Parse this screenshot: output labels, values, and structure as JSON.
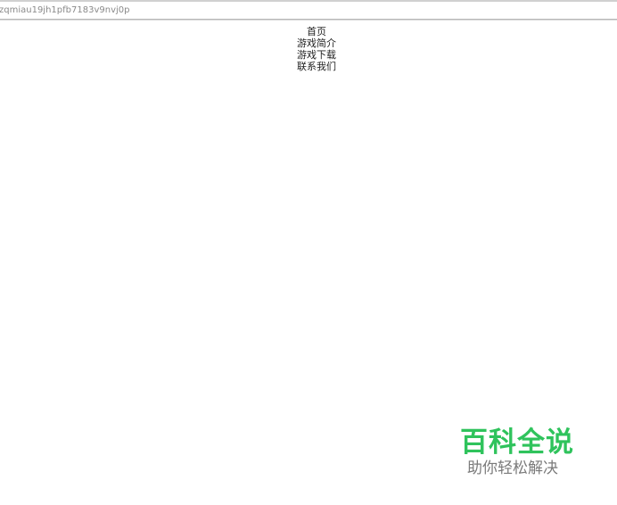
{
  "address_bar": {
    "url": "zqmiau19jh1pfb7183v9nvj0p"
  },
  "nav": {
    "items": [
      {
        "label": "首页"
      },
      {
        "label": "游戏简介"
      },
      {
        "label": "游戏下载"
      },
      {
        "label": "联系我们"
      }
    ]
  },
  "watermark": {
    "title": "百科全说",
    "subtitle": "助你轻松解决",
    "color": "#2fc35c"
  }
}
